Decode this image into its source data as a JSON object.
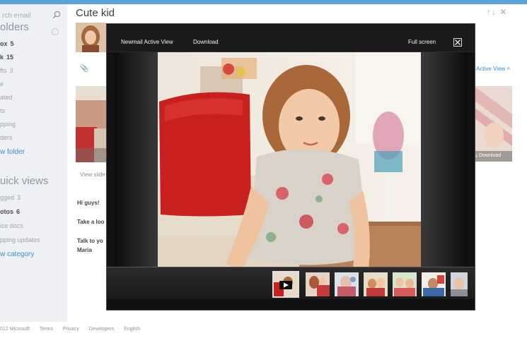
{
  "search": {
    "placeholder": "rch email"
  },
  "sidebar": {
    "folders_heading": "olders",
    "folders": [
      {
        "label": "ox",
        "count": "5",
        "bold": true
      },
      {
        "label": "k",
        "count": "15",
        "bold": true
      },
      {
        "label": "fts",
        "count": "3",
        "bold": false
      },
      {
        "label": "e",
        "count": "",
        "bold": false
      },
      {
        "label": "ated",
        "count": "",
        "bold": false
      },
      {
        "label": "ts",
        "count": "",
        "bold": false
      },
      {
        "label": "pping",
        "count": "",
        "bold": false
      },
      {
        "label": "ders",
        "count": "",
        "bold": false
      }
    ],
    "new_folder": "w folder",
    "quick_heading": "uick views",
    "quick": [
      {
        "label": "gged",
        "count": "3",
        "bold": false
      },
      {
        "label": "otos",
        "count": "6",
        "bold": true
      },
      {
        "label": "ice docs",
        "count": "",
        "bold": false
      },
      {
        "label": "pping updates",
        "count": "",
        "bold": false
      }
    ],
    "new_category": "w category"
  },
  "message": {
    "title": "Cute kid",
    "actions": "↑↓ ✕",
    "attach_icon": "📎",
    "view_slide": "View slide",
    "lines": [
      "Hi guys!",
      "Take a loo",
      "Talk to yo",
      "Maria"
    ],
    "right_active": "Active View ˄",
    "right_download": "⤓ Download"
  },
  "viewer": {
    "app_label": "Newmail Active View",
    "download_label": "Download",
    "fullscreen_label": "Full screen",
    "close_icon": "close-icon",
    "thumbs": 7
  },
  "footer": {
    "copyright": "012 Microsoft",
    "links": [
      "Terms",
      "Privacy",
      "Developers",
      "English"
    ]
  },
  "colors": {
    "accent": "#3f8fd0",
    "topstrip": "#5aa2d8",
    "sidebar_bg": "#eef0f3",
    "viewer_bg": "#121212"
  }
}
